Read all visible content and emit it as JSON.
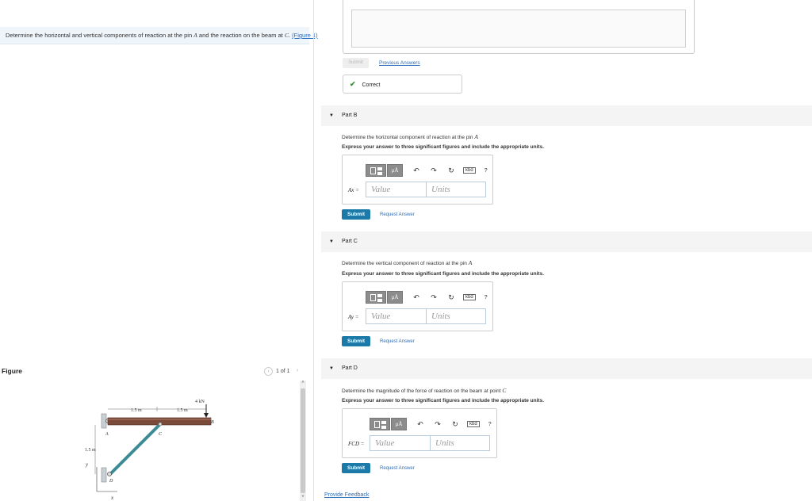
{
  "question": {
    "text": "Determine the horizontal and vertical components of reaction at the pin",
    "pin_var": "A",
    "text2": "and the reaction on the beam at",
    "beam_var": "C",
    "figure_link": "(Figure 1)"
  },
  "figure": {
    "title": "Figure",
    "pager": "1 of 1",
    "labels": {
      "force": "4 kN",
      "dim1": "1.5 m",
      "dim2": "1.5 m",
      "height": "1.5 m",
      "A": "A",
      "B": "B",
      "C": "C",
      "D": "D",
      "x": "x",
      "y": "y"
    }
  },
  "part_a": {
    "submit": "Submit",
    "previous_answers": "Previous Answers",
    "status": "Correct"
  },
  "part_b": {
    "header": "Part B",
    "prompt": "Determine the horizontal component of reaction at the pin",
    "prompt_var": "A",
    "instructions": "Express your answer to three significant figures and include the appropriate units.",
    "var_label": "Ax =",
    "value_placeholder": "Value",
    "units_placeholder": "Units",
    "submit": "Submit",
    "request": "Request Answer"
  },
  "part_c": {
    "header": "Part C",
    "prompt": "Determine the vertical component of reaction at the pin",
    "prompt_var": "A",
    "instructions": "Express your answer to three significant figures and include the appropriate units.",
    "var_label": "Ay =",
    "value_placeholder": "Value",
    "units_placeholder": "Units",
    "submit": "Submit",
    "request": "Request Answer"
  },
  "part_d": {
    "header": "Part D",
    "prompt": "Determine the magnitude of the force of reaction on the beam at point",
    "prompt_var": "C",
    "instructions": "Express your answer to three significant figures and include the appropriate units.",
    "var_label": "FCD =",
    "value_placeholder": "Value",
    "units_placeholder": "Units",
    "submit": "Submit",
    "request": "Request Answer"
  },
  "toolbar": {
    "mu_label": "μÅ",
    "keyboard": "kbd",
    "help": "?"
  },
  "footer": {
    "feedback": "Provide Feedback"
  }
}
